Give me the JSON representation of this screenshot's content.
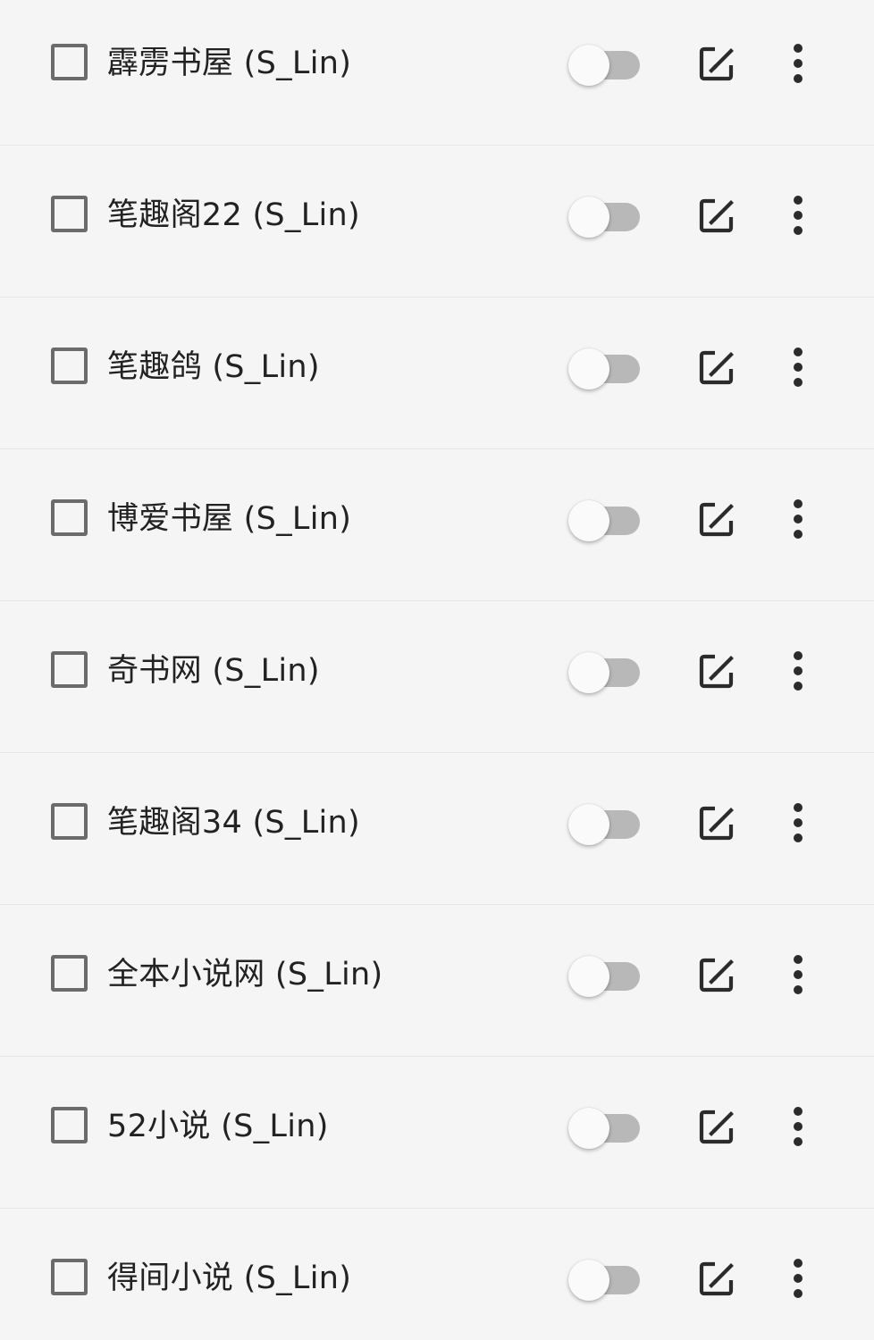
{
  "sources": {
    "items": [
      {
        "name": "霹雳书屋 (S_Lin)",
        "checked": false,
        "enabled": false
      },
      {
        "name": "笔趣阁22 (S_Lin)",
        "checked": false,
        "enabled": false
      },
      {
        "name": "笔趣鸽 (S_Lin)",
        "checked": false,
        "enabled": false
      },
      {
        "name": "博爱书屋 (S_Lin)",
        "checked": false,
        "enabled": false
      },
      {
        "name": "奇书网 (S_Lin)",
        "checked": false,
        "enabled": false
      },
      {
        "name": "笔趣阁34 (S_Lin)",
        "checked": false,
        "enabled": false
      },
      {
        "name": "全本小说网 (S_Lin)",
        "checked": false,
        "enabled": false
      },
      {
        "name": "52小说 (S_Lin)",
        "checked": false,
        "enabled": false
      },
      {
        "name": "得间小说 (S_Lin)",
        "checked": false,
        "enabled": false
      }
    ]
  },
  "icons": {
    "checkbox": "checkbox-unchecked-icon",
    "toggle": "toggle-switch",
    "edit": "edit-icon",
    "more": "more-vert-icon"
  },
  "colors": {
    "background": "#f5f5f5",
    "divider": "#e6e6e6",
    "text": "#222222",
    "icon": "#2b2b2b",
    "checkbox_border": "#6b6b6b",
    "switch_track_off": "#b8b8b8",
    "switch_thumb_off": "#fafafa"
  }
}
